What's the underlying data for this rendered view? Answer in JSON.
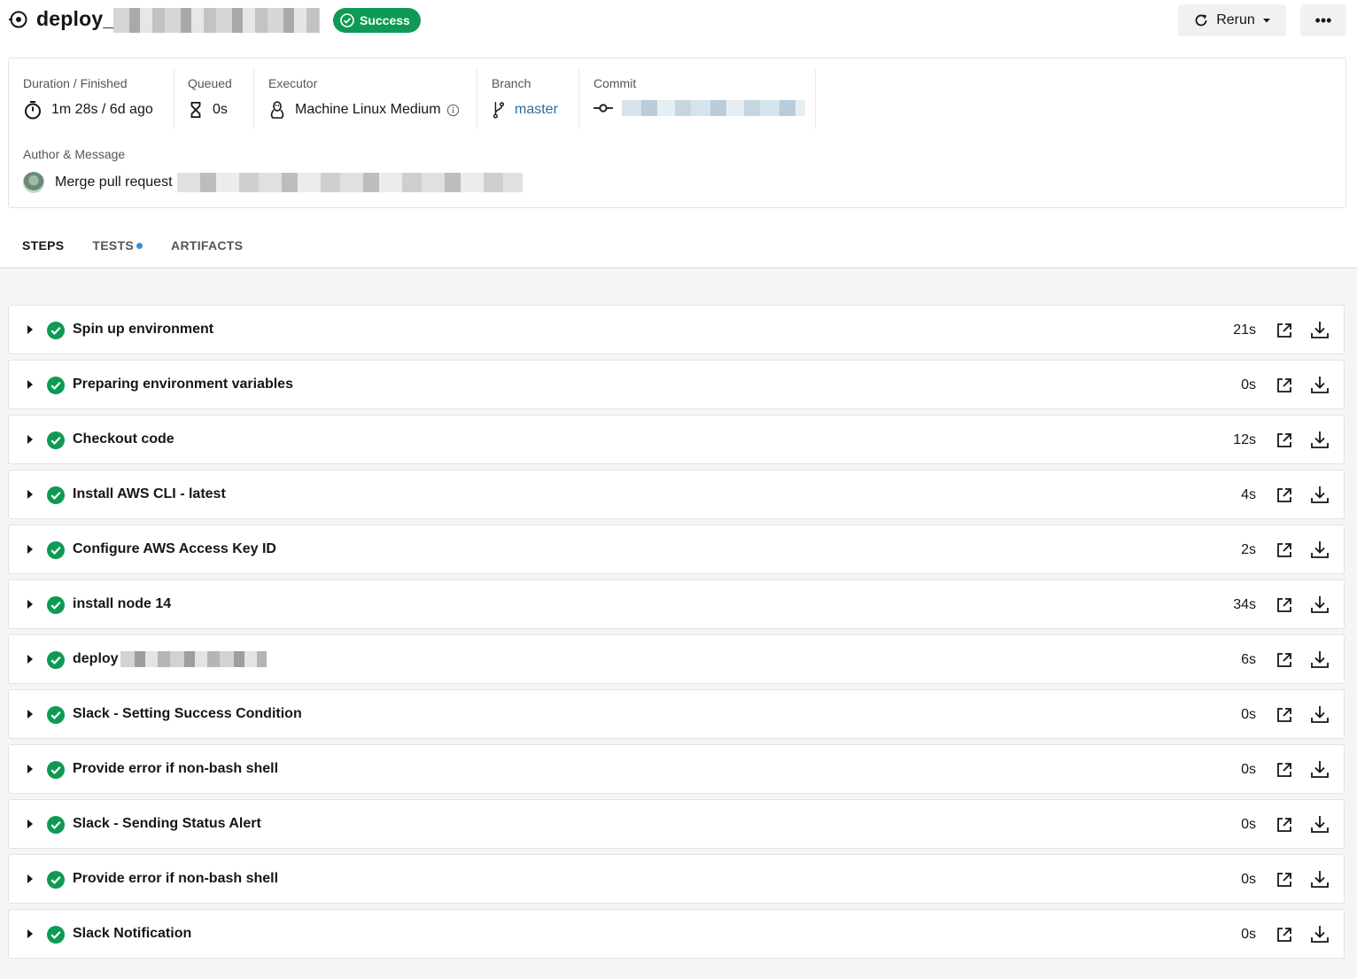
{
  "header": {
    "job_title": "deploy_",
    "status": "Success",
    "rerun_label": "Rerun",
    "more_label": "•••"
  },
  "info": {
    "duration_label": "Duration / Finished",
    "duration_value": "1m 28s / 6d ago",
    "queued_label": "Queued",
    "queued_value": "0s",
    "executor_label": "Executor",
    "executor_value": "Machine Linux Medium",
    "branch_label": "Branch",
    "branch_value": "master",
    "commit_label": "Commit",
    "author_label": "Author & Message",
    "message_prefix": "Merge pull request"
  },
  "tabs": [
    {
      "label": "STEPS",
      "active": true
    },
    {
      "label": "TESTS",
      "dot": true
    },
    {
      "label": "ARTIFACTS"
    }
  ],
  "steps": [
    {
      "name": "Spin up environment",
      "duration": "21s"
    },
    {
      "name": "Preparing environment variables",
      "duration": "0s"
    },
    {
      "name": "Checkout code",
      "duration": "12s"
    },
    {
      "name": "Install AWS CLI - latest",
      "duration": "4s"
    },
    {
      "name": "Configure AWS Access Key ID",
      "duration": "2s"
    },
    {
      "name": "install node 14",
      "duration": "34s"
    },
    {
      "name": "deploy",
      "duration": "6s"
    },
    {
      "name": "Slack - Setting Success Condition",
      "duration": "0s"
    },
    {
      "name": "Provide error if non-bash shell",
      "duration": "0s"
    },
    {
      "name": "Slack - Sending Status Alert",
      "duration": "0s"
    },
    {
      "name": "Provide error if non-bash shell",
      "duration": "0s"
    },
    {
      "name": "Slack Notification",
      "duration": "0s"
    }
  ],
  "colors": {
    "success": "#0e9a54",
    "branch_link": "#2b6ea1",
    "tab_dot": "#3a8fd6"
  }
}
